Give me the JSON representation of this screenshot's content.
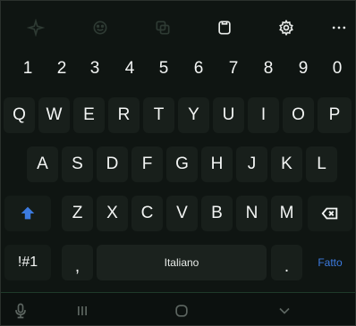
{
  "toolbar": {
    "icons": [
      "sticker-icon",
      "emoji-icon",
      "translate-icon",
      "clipboard-icon",
      "settings-icon",
      "more-icon"
    ]
  },
  "number_row": [
    "1",
    "2",
    "3",
    "4",
    "5",
    "6",
    "7",
    "8",
    "9",
    "0"
  ],
  "row_1": [
    "Q",
    "W",
    "E",
    "R",
    "T",
    "Y",
    "U",
    "I",
    "O",
    "P"
  ],
  "row_2": [
    "A",
    "S",
    "D",
    "F",
    "G",
    "H",
    "J",
    "K",
    "L"
  ],
  "row_3": [
    "Z",
    "X",
    "C",
    "V",
    "B",
    "N",
    "M"
  ],
  "bottom_row": {
    "symbols_label": "!#1",
    "comma_label": ",",
    "space_label": "Italiano",
    "period_label": ".",
    "done_label": "Fatto"
  },
  "colors": {
    "background": "#0f1512",
    "key": "#181f1b",
    "key_text": "#f3f5f4",
    "accent": "#3c7be0"
  }
}
